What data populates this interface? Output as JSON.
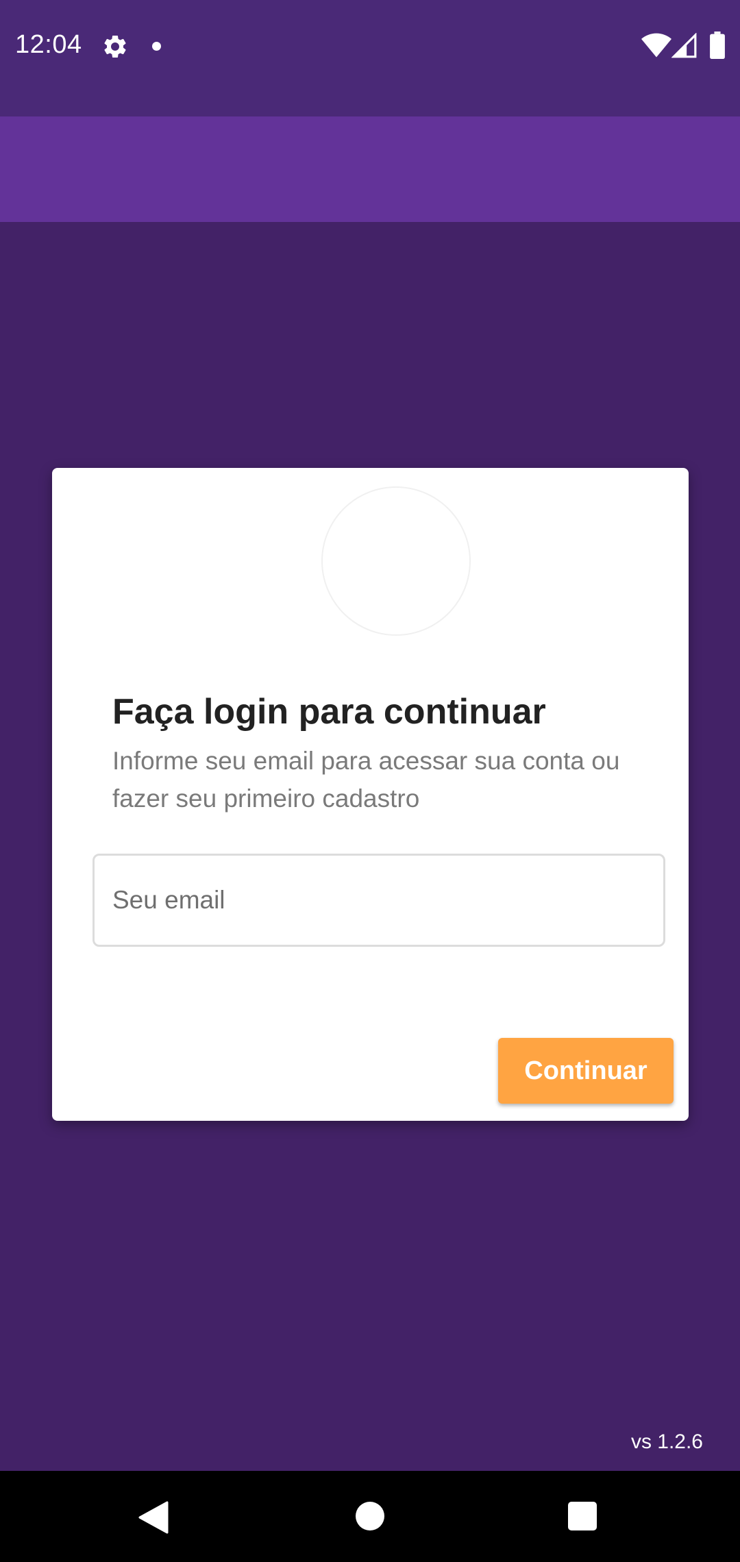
{
  "status_bar": {
    "time": "12:04",
    "icons": [
      "gear-icon",
      "notification-dot-icon",
      "wifi-icon",
      "signal-icon",
      "battery-icon"
    ]
  },
  "login_card": {
    "title": "Faça login para continuar",
    "subtitle": "Informe seu email para acessar sua conta ou fazer seu primeiro cadastro",
    "email_placeholder": "Seu email",
    "email_value": "",
    "continue_label": "Continuar"
  },
  "footer": {
    "version": "vs 1.2.6"
  },
  "nav_bar": {
    "icons": [
      "back-icon",
      "home-icon",
      "recents-icon"
    ]
  },
  "colors": {
    "background": "#432267",
    "status_bar": "#4a2977",
    "app_bar": "#633399",
    "card": "#ffffff",
    "button": "#ffa442",
    "title_text": "#222222",
    "subtitle_text": "#7a7a7a"
  }
}
